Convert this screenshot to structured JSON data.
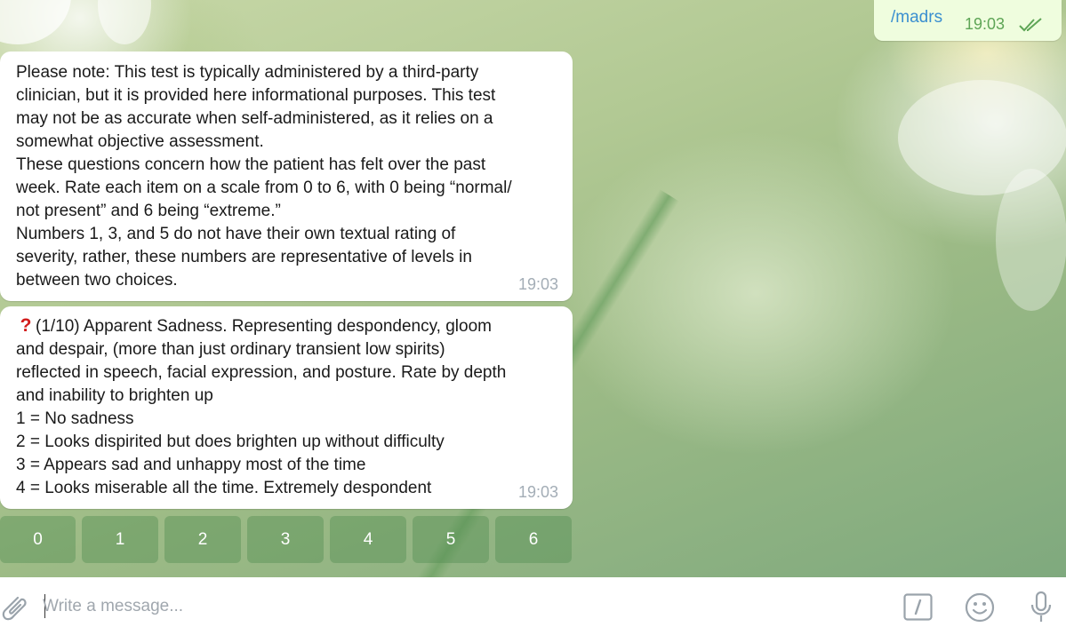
{
  "outgoing": {
    "text": "/madrs",
    "time": "19:03"
  },
  "messages": [
    {
      "lines": [
        "Please note: This test is typically administered by a third-party",
        "clinician, but it is provided here informational purposes. This test",
        "may not be as accurate when self-administered, as it relies on a",
        "somewhat objective assessment.",
        "These questions concern how the patient has felt over the past",
        "week. Rate each item on a scale from 0 to 6, with 0 being “normal/",
        "not present” and 6 being “extreme.”",
        "Numbers 1, 3, and 5 do not have their own textual rating of",
        "severity, rather, these numbers are representative of levels in",
        "between two choices."
      ],
      "time": "19:03"
    },
    {
      "lines": [
        "(1/10) Apparent Sadness. Representing despondency, gloom",
        "and despair, (more than just ordinary transient low spirits)",
        "reflected in speech, facial expression, and posture. Rate by depth",
        "and inability to brighten up",
        "1 = No sadness",
        "2 = Looks dispirited but does brighten up without difficulty",
        "3 = Appears sad and unhappy most of the time",
        "4 = Looks miserable all the time. Extremely despondent"
      ],
      "time": "19:03",
      "icon": "question-mark-icon"
    }
  ],
  "keyboard": [
    "0",
    "1",
    "2",
    "3",
    "4",
    "5",
    "6"
  ],
  "composer": {
    "placeholder": "Write a message...",
    "icons": [
      "paperclip-icon",
      "slash-commands-icon",
      "emoji-icon",
      "microphone-icon"
    ]
  },
  "colors": {
    "outgoing_bubble": "#effdde",
    "command_link": "#3a8fd0",
    "outgoing_time": "#5ea556",
    "question_mark": "#d21c1c"
  }
}
